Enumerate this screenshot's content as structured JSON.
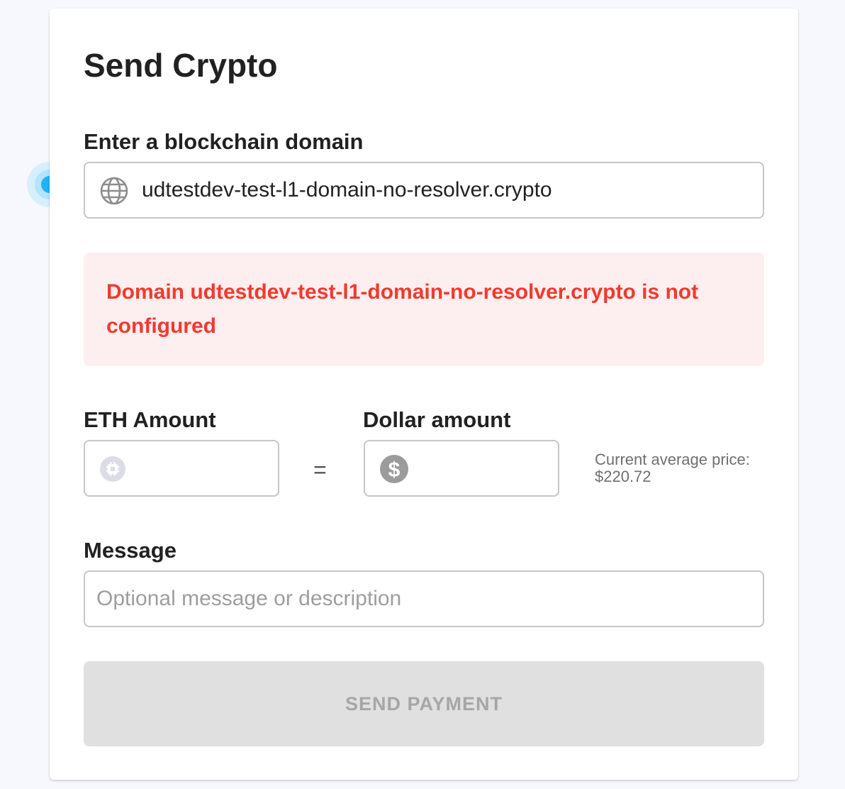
{
  "page": {
    "title": "Send Crypto"
  },
  "domain": {
    "label": "Enter a blockchain domain",
    "value": "udtestdev-test-l1-domain-no-resolver.crypto",
    "icon": "globe-icon"
  },
  "error": {
    "message": "Domain udtestdev-test-l1-domain-no-resolver.crypto is not configured"
  },
  "eth": {
    "label": "ETH Amount",
    "value": "",
    "icon": "eth-token-icon"
  },
  "equals": "=",
  "dollar": {
    "label": "Dollar amount",
    "value": "",
    "icon": "dollar-icon"
  },
  "price": {
    "text": "Current average price: $220.72"
  },
  "message": {
    "label": "Message",
    "placeholder": "Optional message or description",
    "value": ""
  },
  "send_button": {
    "label": "SEND PAYMENT"
  },
  "colors": {
    "error_text": "#f03a2e",
    "error_bg": "#fdeeef",
    "button_disabled_bg": "#e0e0e0",
    "cursor_accent": "#1eb4f5"
  }
}
